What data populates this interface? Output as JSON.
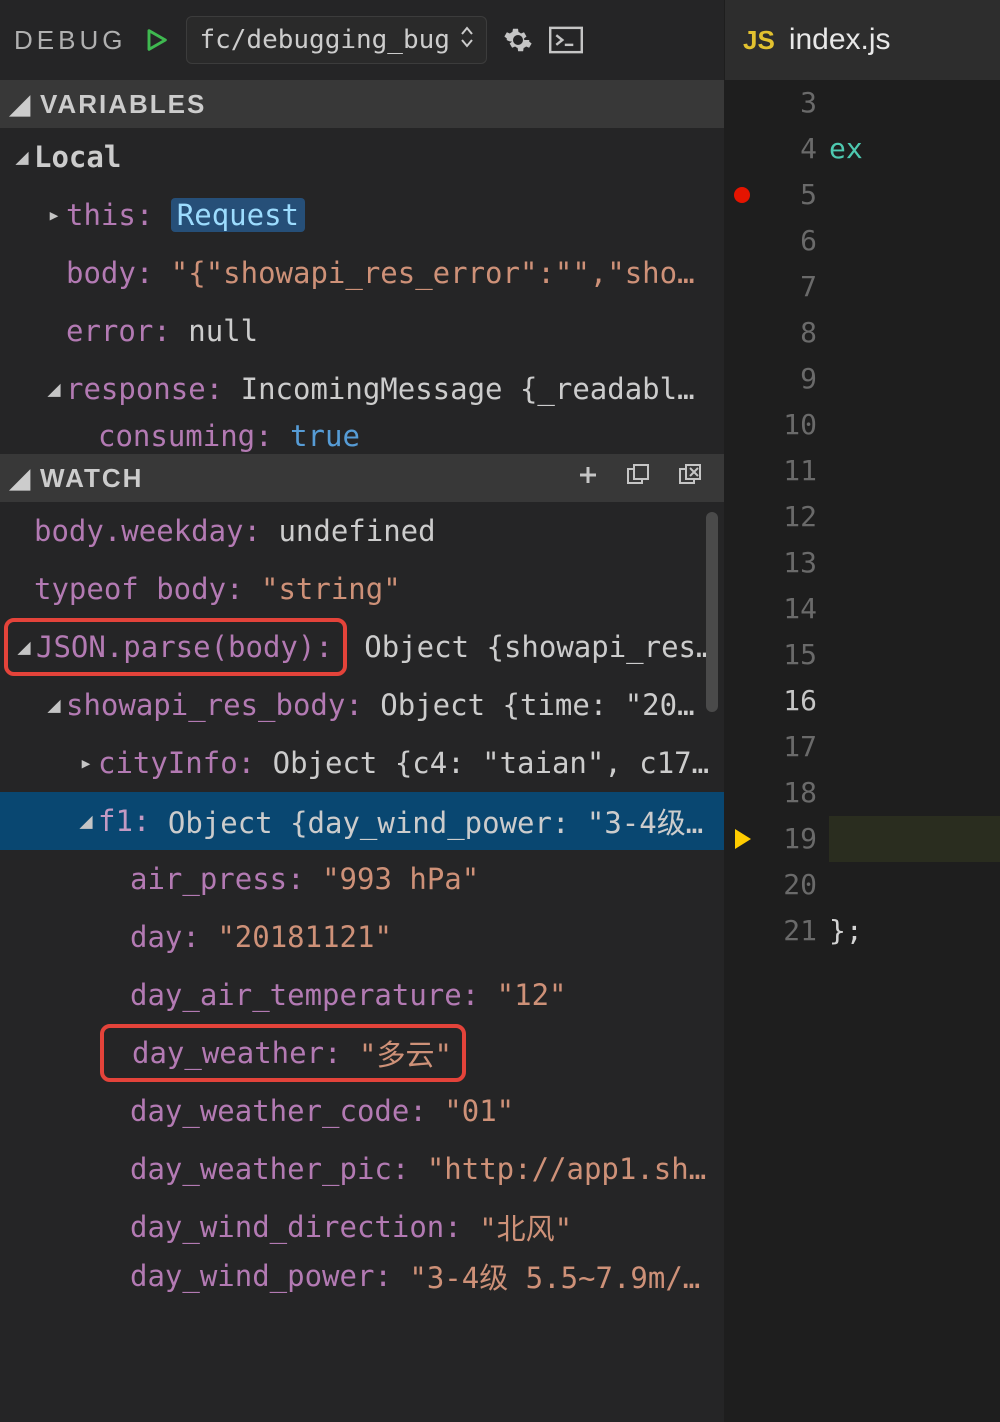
{
  "debug": {
    "label": "DEBUG",
    "config_name": "fc/debugging_bug"
  },
  "sections": {
    "variables": "VARIABLES",
    "watch": "WATCH"
  },
  "variables": {
    "scope": "Local",
    "items": {
      "this_key": "this:",
      "this_val": "Request",
      "body_key": "body:",
      "body_val": "\"{\"showapi_res_error\":\"\",\"sho…",
      "error_key": "error:",
      "error_val": "null",
      "response_key": "response:",
      "response_val": "IncomingMessage {_readabl…",
      "consuming_key": "consuming:",
      "consuming_val": "true"
    }
  },
  "watch": {
    "r1_key": "body.weekday:",
    "r1_val": "undefined",
    "r2_key": "typeof body:",
    "r2_val": "\"string\"",
    "r3_key": "JSON.parse(body):",
    "r3_val": "Object {showapi_res…",
    "r4_key": "showapi_res_body:",
    "r4_val": "Object {time: \"20…",
    "r5_key": "cityInfo:",
    "r5_val": "Object {c4: \"taian\", c17…",
    "r6_key": "f1:",
    "r6_val": "Object {day_wind_power: \"3-4级…",
    "r7_key": "air_press:",
    "r7_val": "\"993 hPa\"",
    "r8_key": "day:",
    "r8_val": "\"20181121\"",
    "r9_key": "day_air_temperature:",
    "r9_val": "\"12\"",
    "r10_key": "day_weather:",
    "r10_val": "\"多云\"",
    "r11_key": "day_weather_code:",
    "r11_val": "\"01\"",
    "r12_key": "day_weather_pic:",
    "r12_val": "\"http://app1.sh…",
    "r13_key": "day_wind_direction:",
    "r13_val": "\"北风\"",
    "r14_key": "day_wind_power:",
    "r14_val": "\"3-4级 5.5~7.9m/…"
  },
  "editor": {
    "tab_name": "index.js",
    "lines": [
      "3",
      "4",
      "5",
      "6",
      "7",
      "8",
      "9",
      "10",
      "11",
      "12",
      "13",
      "14",
      "15",
      "16",
      "17",
      "18",
      "19",
      "20",
      "21"
    ],
    "code4": "ex",
    "code21": "};",
    "breakpoints": {
      "5": "dot",
      "19": "pc"
    },
    "active_line": "16"
  }
}
